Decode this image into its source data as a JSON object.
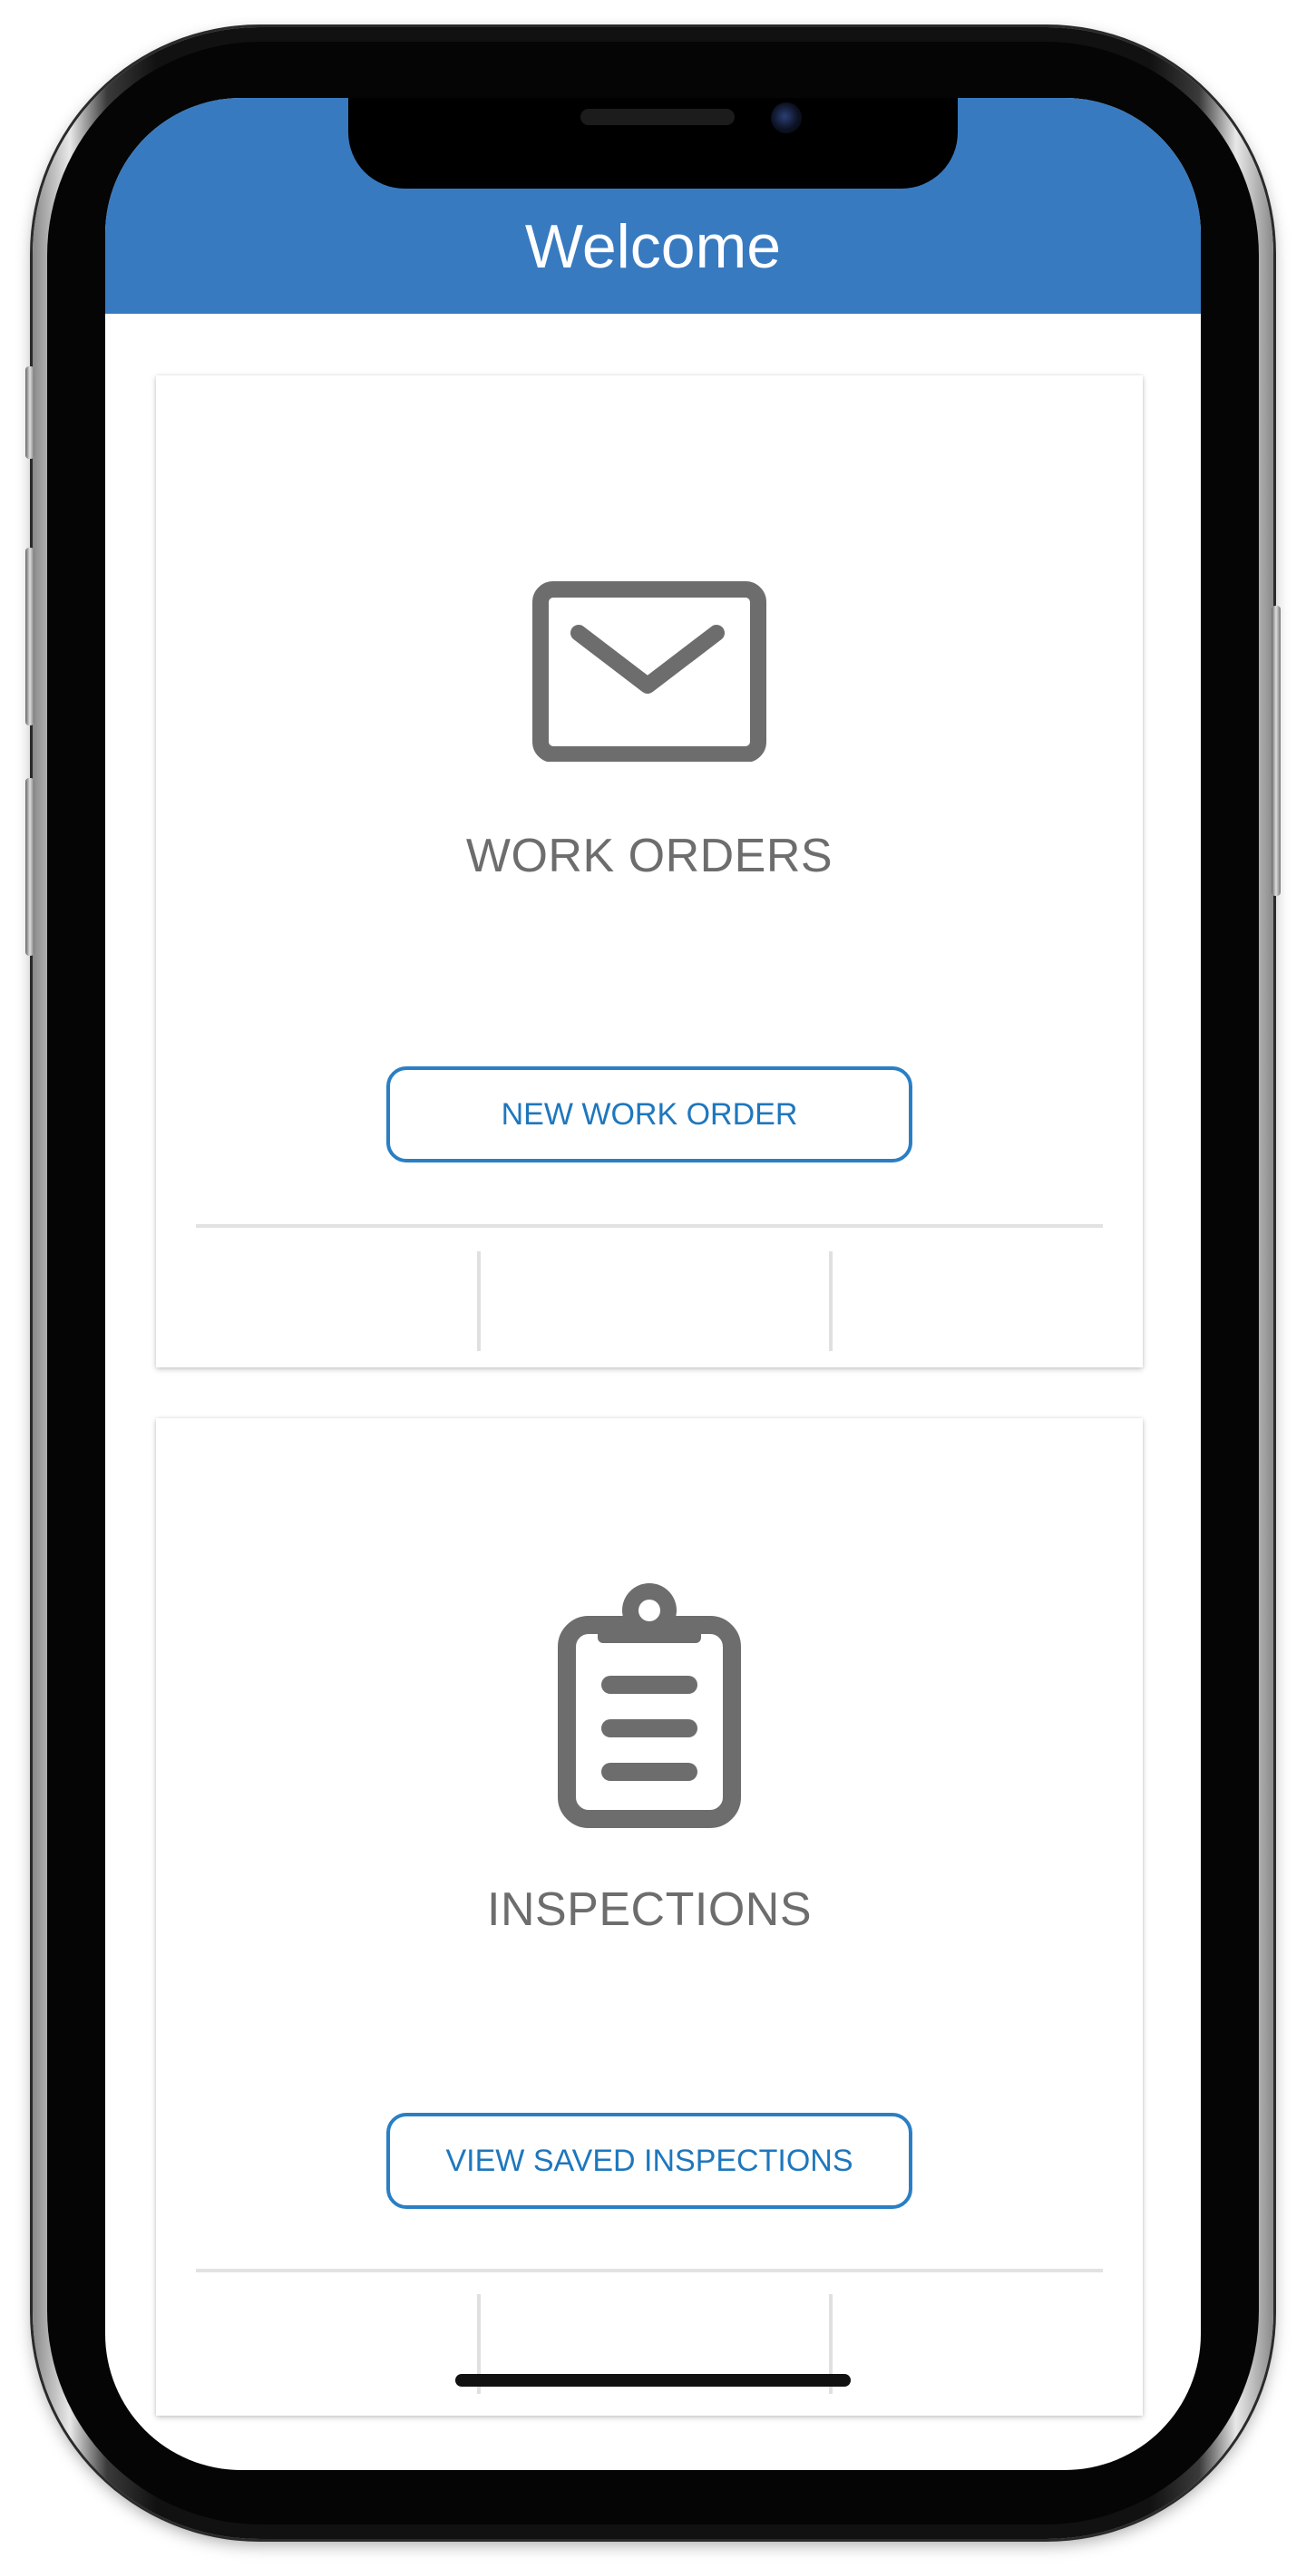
{
  "header": {
    "title": "Welcome"
  },
  "cards": [
    {
      "icon": "envelope-icon",
      "title": "WORK ORDERS",
      "button_label": "NEW WORK ORDER"
    },
    {
      "icon": "clipboard-icon",
      "title": "INSPECTIONS",
      "button_label": "VIEW SAVED INSPECTIONS"
    }
  ],
  "colors": {
    "header_bg": "#387ac0",
    "accent": "#2a7fc4",
    "icon": "#6d6d6d",
    "divider": "#e2e2e2"
  }
}
